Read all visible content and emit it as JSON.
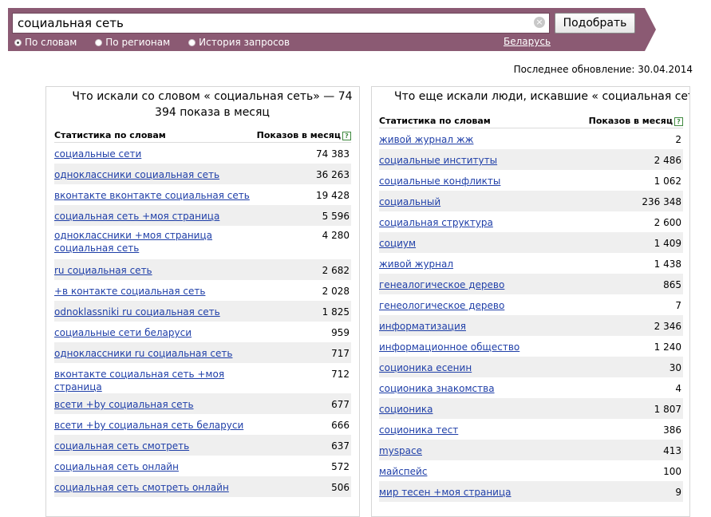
{
  "search": {
    "query": "социальная сеть",
    "clear_symbol": "×",
    "submit_label": "Подобрать"
  },
  "modes": [
    {
      "label": "По словам",
      "checked": true
    },
    {
      "label": "По регионам",
      "checked": false
    },
    {
      "label": "История запросов",
      "checked": false
    }
  ],
  "region": "Беларусь",
  "last_update": "Последнее обновление: 30.04.2014",
  "colors": {
    "bar": "#8b5a73",
    "link": "#1f3fa8",
    "row_alt": "#efefef"
  },
  "left": {
    "title": "Что искали со словом « социальная сеть» — 74 394 показа в месяц",
    "col_phrase": "Статистика по словам",
    "col_count": "Показов в месяц",
    "help": "?",
    "rows": [
      {
        "phrase": "социальные сети",
        "count": "74 383"
      },
      {
        "phrase": "одноклассники социальная сеть",
        "count": "36 263"
      },
      {
        "phrase": "вконтакте вконтакте социальная сеть",
        "count": "19 428"
      },
      {
        "phrase": "социальная сеть +моя страница",
        "count": "5 596"
      },
      {
        "phrase": "одноклассники +моя страница социальная сеть",
        "count": "4 280"
      },
      {
        "phrase": "ru социальная сеть",
        "count": "2 682"
      },
      {
        "phrase": "+в контакте социальная сеть",
        "count": "2 028"
      },
      {
        "phrase": "odnoklassniki ru социальная сеть",
        "count": "1 825"
      },
      {
        "phrase": "социальные сети беларуси",
        "count": "959"
      },
      {
        "phrase": "одноклассники ru социальная сеть",
        "count": "717"
      },
      {
        "phrase": "вконтакте социальная сеть +моя страница",
        "count": "712"
      },
      {
        "phrase": "всети +by социальная сеть",
        "count": "677"
      },
      {
        "phrase": "всети +by социальная сеть беларуси",
        "count": "666"
      },
      {
        "phrase": "социальная сеть смотреть",
        "count": "637"
      },
      {
        "phrase": "социальная сеть онлайн",
        "count": "572"
      },
      {
        "phrase": "социальная сеть смотреть онлайн",
        "count": "506"
      }
    ]
  },
  "right": {
    "title": "Что еще искали люди, искавшие « социальная сеть»:",
    "col_phrase": "Статистика по словам",
    "col_count": "Показов в месяц",
    "help": "?",
    "rows": [
      {
        "phrase": "живой журнал жж",
        "count": "2"
      },
      {
        "phrase": "социальные институты",
        "count": "2 486"
      },
      {
        "phrase": "социальные конфликты",
        "count": "1 062"
      },
      {
        "phrase": "социальный",
        "count": "236 348"
      },
      {
        "phrase": "социальная структура",
        "count": "2 600"
      },
      {
        "phrase": "социум",
        "count": "1 409"
      },
      {
        "phrase": "живой журнал",
        "count": "1 438"
      },
      {
        "phrase": "генеалогическое дерево",
        "count": "865"
      },
      {
        "phrase": "генеологическое дерево",
        "count": "7"
      },
      {
        "phrase": "информатизация",
        "count": "2 346"
      },
      {
        "phrase": "информационное общество",
        "count": "1 240"
      },
      {
        "phrase": "соционика есенин",
        "count": "30"
      },
      {
        "phrase": "соционика знакомства",
        "count": "4"
      },
      {
        "phrase": "соционика",
        "count": "1 807"
      },
      {
        "phrase": "соционика тест",
        "count": "386"
      },
      {
        "phrase": "myspace",
        "count": "413"
      },
      {
        "phrase": "майспейс",
        "count": "100"
      },
      {
        "phrase": "мир тесен +моя страница",
        "count": "9"
      }
    ]
  }
}
